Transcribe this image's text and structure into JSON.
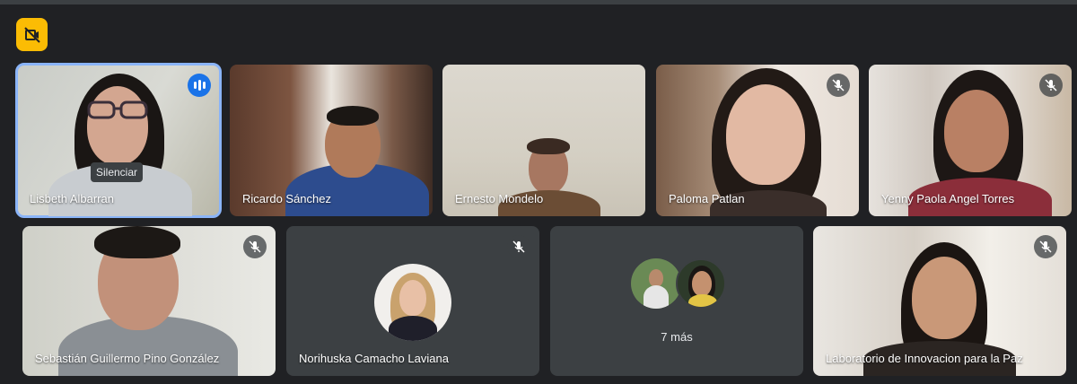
{
  "participants": [
    {
      "name": "Lisbeth Albarran",
      "tooltip": "Silenciar"
    },
    {
      "name": "Ricardo Sánchez"
    },
    {
      "name": "Ernesto Mondelo"
    },
    {
      "name": "Paloma Patlan"
    },
    {
      "name": "Yenny Paola Angel Torres"
    },
    {
      "name": "Sebastián Guillermo Pino González"
    },
    {
      "name": "Norihuska Camacho Laviana"
    },
    {
      "name": "7 más"
    },
    {
      "name": "Laboratorio de Innovacion para la Paz"
    }
  ],
  "icons": {
    "badge": "no-video-icon",
    "muted": "mic-off-icon",
    "speaking": "audio-level-icon"
  },
  "colors": {
    "background": "#202124",
    "tile": "#3c4043",
    "active_border": "#8ab4f8",
    "badge": "#fbbc04",
    "speaking": "#1a73e8"
  }
}
